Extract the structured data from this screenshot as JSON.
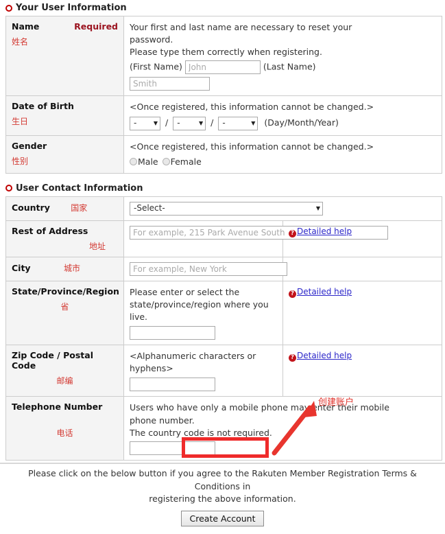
{
  "sections": {
    "user_info": {
      "heading": "Your User Information",
      "bullet_icon": "ring-bullet-icon"
    },
    "contact_info": {
      "heading": "User Contact Information",
      "bullet_icon": "ring-bullet-icon"
    }
  },
  "rows": {
    "name": {
      "label": "Name",
      "required": "Required",
      "label_cn": "姓名",
      "note_line1": "Your first and last name are necessary to reset your",
      "note_line2": "password.",
      "note_line3": "Please type them correctly when registering.",
      "first_name_label": "(First Name)",
      "first_name_placeholder": "John",
      "first_name_value": "",
      "last_name_label": "(Last Name)",
      "last_name_placeholder": "Smith",
      "last_name_value": ""
    },
    "dob": {
      "label": "Date of Birth",
      "label_cn": "生日",
      "note": "<Once registered, this information cannot be changed.>",
      "day_value": "-",
      "month_value": "-",
      "year_value": "-",
      "separator": "/",
      "format_note": "(Day/Month/Year)",
      "arrow_icon": "chevron-down-icon"
    },
    "gender": {
      "label": "Gender",
      "label_cn": "性别",
      "note": "<Once registered, this information cannot be changed.>",
      "male_label": "Male",
      "female_label": "Female",
      "selected": ""
    },
    "country": {
      "label": "Country",
      "label_cn": "国家",
      "selected_option": "-Select-",
      "arrow_icon": "chevron-down-icon"
    },
    "address": {
      "label": "Rest of Address",
      "label_cn": "地址",
      "placeholder": "For example, 215 Park Avenue South",
      "value": "",
      "help_label": "Detailed help",
      "help_icon": "question-mark-icon"
    },
    "city": {
      "label": "City",
      "label_cn": "城市",
      "placeholder": "For example, New York",
      "value": ""
    },
    "state": {
      "label": "State/Province/Region",
      "label_cn": "省",
      "note": "Please enter or select the state/province/region where you live.",
      "value": "",
      "help_label": "Detailed help",
      "help_icon": "question-mark-icon"
    },
    "zip": {
      "label": "Zip Code / Postal Code",
      "label_cn": "邮编",
      "note": "<Alphanumeric characters or hyphens>",
      "value": "",
      "help_label": "Detailed help",
      "help_icon": "question-mark-icon"
    },
    "telephone": {
      "label": "Telephone Number",
      "label_cn": "电话",
      "note_line1": "Users who have only a mobile phone may enter their mobile",
      "note_line2": "phone number.",
      "note_line3": "The country code is not required.",
      "value": ""
    }
  },
  "footer": {
    "terms_line1": "Please click on the below button if you agree to the Rakuten Member Registration Terms & Conditions in",
    "terms_line2": "registering the above information.",
    "create_button": "Create Account"
  },
  "annotations": {
    "create_account_cn": "创建账户",
    "arrow_icon": "red-arrow-icon",
    "highlight_box": "red-highlight-box",
    "highlight_color": "#ef2b2b",
    "annotation_color": "#e0332c"
  }
}
